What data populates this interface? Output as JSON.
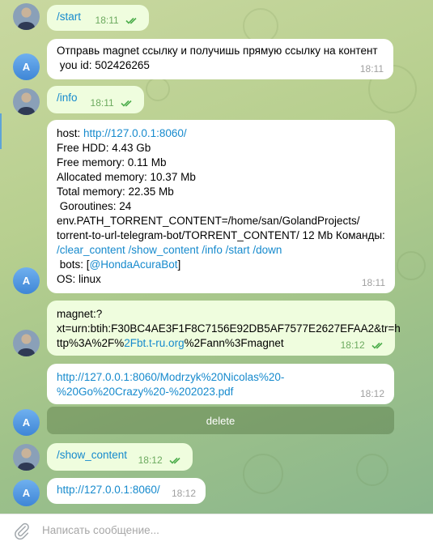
{
  "messages": [
    {
      "text": "/start",
      "time": "18:11"
    },
    {
      "avatar": "A",
      "line1": "Отправь magnet ссылку и получишь прямую ссылку на контент",
      "line2": " you id: 502426265",
      "time": "18:11"
    },
    {
      "text": "/info",
      "time": "18:11"
    },
    {
      "avatar": "A",
      "host_label": "host: ",
      "host_link": "http://127.0.0.1:8060/",
      "free_hdd": "Free HDD: 4.43 Gb",
      "free_memory": "Free memory: 0.11 Mb",
      "allocated_memory": "Allocated memory: 10.37 Mb",
      "total_memory": "Total memory: 22.35 Mb",
      "goroutines": " Goroutines: 24",
      "env_line1": "env.PATH_TORRENT_CONTENT=/home/san/GolandProjects/",
      "env_line2": "torrent-to-url-telegram-bot/TORRENT_CONTENT/ 12 Mb Команды:",
      "commands": "/clear_content /show_content /info /start /down",
      "bots_prefix": " bots: [",
      "bots_link": "@HondaAcuraBot",
      "bots_suffix": "]",
      "os": "OS: linux",
      "time": "18:11"
    },
    {
      "line1": "magnet:?",
      "line2": "xt=urn:btih:F30BC4AE3F1F8C7156E92DB5AF7577E2627EFAA2&tr=h",
      "line3_prefix": "ttp%3A%2F%",
      "line3_link": "2Fbt.t-ru.org",
      "line3_suffix": "%2Fann%3Fmagnet",
      "time": "18:12"
    },
    {
      "avatar": "A",
      "line1": "http://127.0.0.1:8060/Modrzyk%20Nicolas%20-",
      "line2": "%20Go%20Crazy%20-%202023.pdf",
      "time": "18:12",
      "button": "delete"
    },
    {
      "text": "/show_content",
      "time": "18:12"
    },
    {
      "avatar": "A",
      "text": "http://127.0.0.1:8060/",
      "time": "18:12"
    }
  ],
  "composer": {
    "placeholder": "Написать сообщение..."
  },
  "colors": {
    "link": "#168acd",
    "outgoing": "#effdde",
    "incoming": "#ffffff",
    "check": "#4fae4e"
  }
}
